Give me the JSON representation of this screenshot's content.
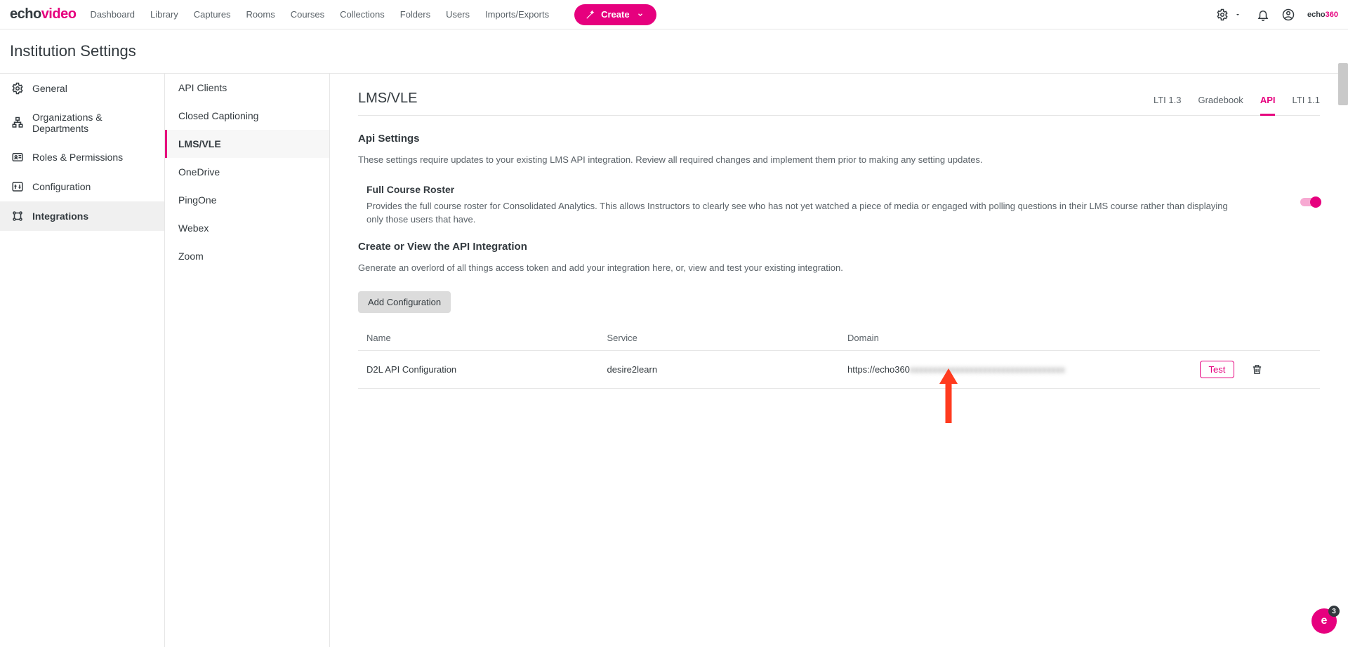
{
  "brand": {
    "part1": "echo",
    "part2": "video",
    "mini1": "echo",
    "mini2": "360"
  },
  "nav": {
    "items": [
      "Dashboard",
      "Library",
      "Captures",
      "Rooms",
      "Courses",
      "Collections",
      "Folders",
      "Users",
      "Imports/Exports"
    ],
    "create": "Create"
  },
  "page": {
    "title": "Institution Settings"
  },
  "sidebar1": {
    "items": [
      {
        "label": "General"
      },
      {
        "label": "Organizations & Departments"
      },
      {
        "label": "Roles & Permissions"
      },
      {
        "label": "Configuration"
      },
      {
        "label": "Integrations",
        "selected": true
      }
    ]
  },
  "sidebar2": {
    "items": [
      {
        "label": "API Clients"
      },
      {
        "label": "Closed Captioning"
      },
      {
        "label": "LMS/VLE",
        "selected": true
      },
      {
        "label": "OneDrive"
      },
      {
        "label": "PingOne"
      },
      {
        "label": "Webex"
      },
      {
        "label": "Zoom"
      }
    ]
  },
  "content": {
    "title": "LMS/VLE",
    "tabs": [
      {
        "label": "LTI 1.3"
      },
      {
        "label": "Gradebook"
      },
      {
        "label": "API",
        "active": true
      },
      {
        "label": "LTI 1.1"
      }
    ],
    "apiSettings": {
      "heading": "Api Settings",
      "desc": "These settings require updates to your existing LMS API integration. Review all required changes and implement them prior to making any setting updates."
    },
    "roster": {
      "heading": "Full Course Roster",
      "desc": "Provides the full course roster for Consolidated Analytics. This allows Instructors to clearly see who has not yet watched a piece of media or engaged with polling questions in their LMS course rather than displaying only those users that have.",
      "toggle_on": true
    },
    "createView": {
      "heading": "Create or View the API Integration",
      "desc": "Generate an overlord of all things access token and add your integration here, or, view and test your existing integration."
    },
    "addConfig": "Add Configuration",
    "table": {
      "headers": {
        "name": "Name",
        "service": "Service",
        "domain": "Domain"
      },
      "rows": [
        {
          "name": "D2L API Configuration",
          "service": "desire2learn",
          "domain_visible": "https://echo360",
          "domain_hidden": "xxxxxxxxxxxxxxxxxxxxxxxxxxxxxxxxxx",
          "test": "Test"
        }
      ]
    }
  },
  "float": {
    "glyph": "e",
    "count": "3"
  }
}
